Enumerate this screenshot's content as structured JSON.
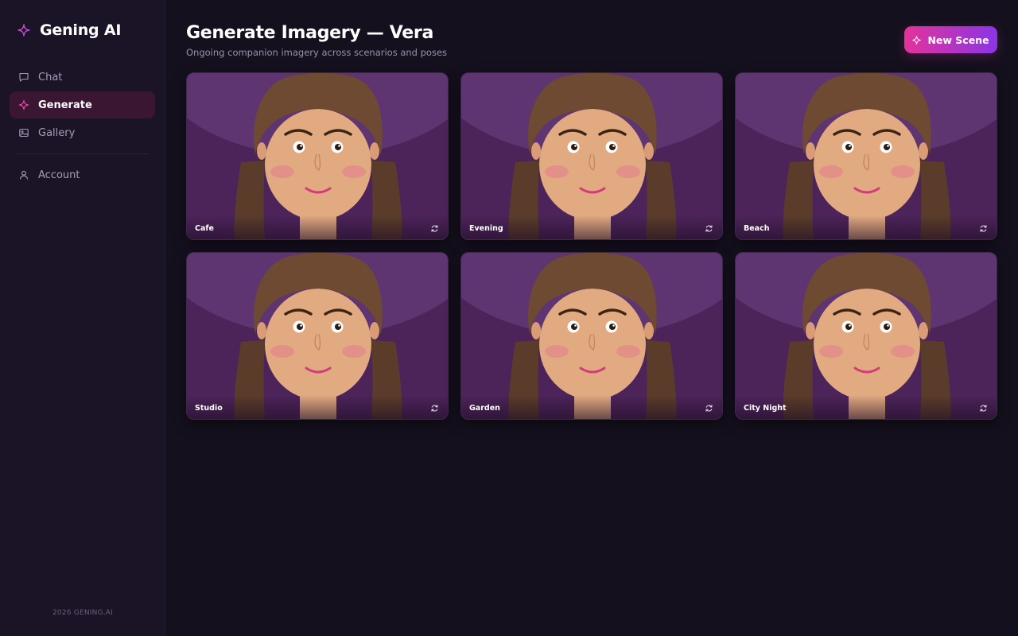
{
  "brand": {
    "title": "Gening AI",
    "icon": "sparkle-icon",
    "accent": "#d946a8"
  },
  "nav": {
    "items": [
      {
        "label": "Chat",
        "icon": "chat-icon",
        "active": false
      },
      {
        "label": "Generate",
        "icon": "sparkle-icon",
        "active": true
      },
      {
        "label": "Gallery",
        "icon": "image-icon",
        "active": false
      }
    ],
    "account": {
      "label": "Account",
      "icon": "user-icon"
    }
  },
  "footer": {
    "text": "2026 GENING.AI"
  },
  "header": {
    "title": "Generate Imagery — Vera",
    "subtitle": "Ongoing companion imagery across scenarios and poses",
    "new_scene_label": "New Scene",
    "new_scene_icon": "sparkle-icon"
  },
  "scenes": [
    {
      "label": "Cafe",
      "icon": "refresh-icon"
    },
    {
      "label": "Evening",
      "icon": "refresh-icon"
    },
    {
      "label": "Beach",
      "icon": "refresh-icon"
    },
    {
      "label": "Studio",
      "icon": "refresh-icon"
    },
    {
      "label": "Garden",
      "icon": "refresh-icon"
    },
    {
      "label": "City Night",
      "icon": "refresh-icon"
    }
  ],
  "colors": {
    "background": "#15101e",
    "sidebar": "#1a1426",
    "active_nav": "#3a1632",
    "button_gradient_start": "#e3339b",
    "button_gradient_end": "#8b35e6",
    "card_background": "#4b2358"
  }
}
